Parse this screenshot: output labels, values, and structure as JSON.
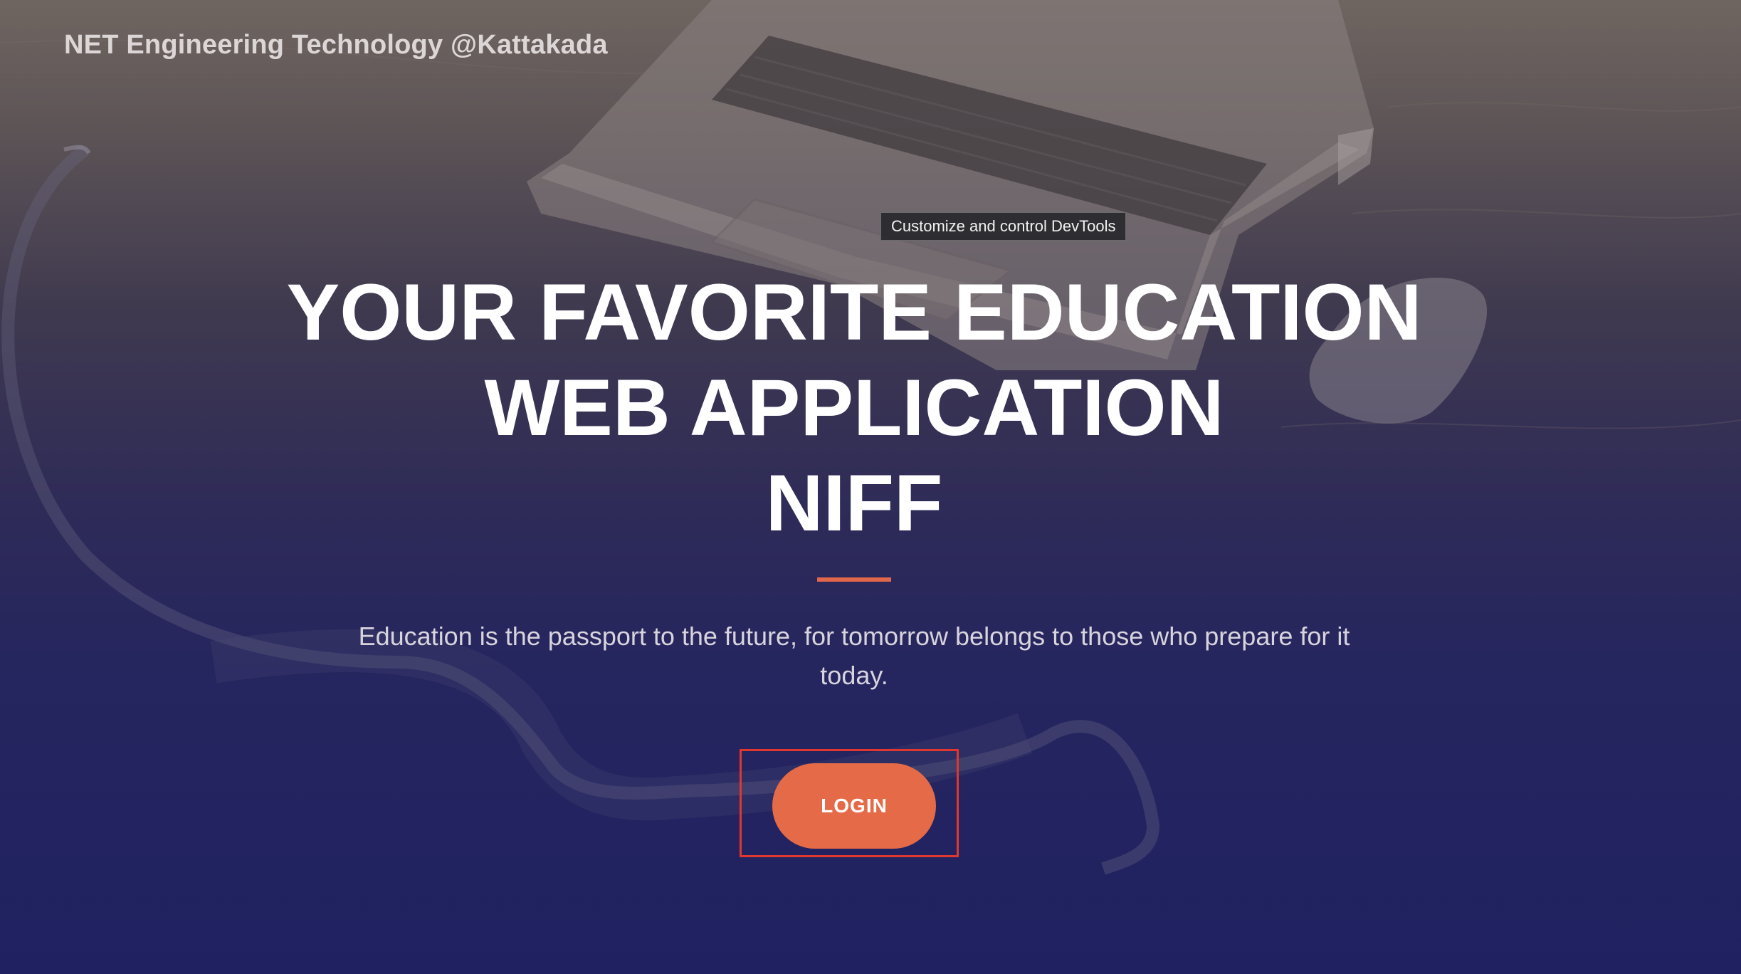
{
  "header": {
    "brand": "NET Engineering Technology @Kattakada"
  },
  "tooltip": {
    "text": "Customize and control DevTools"
  },
  "hero": {
    "headline_line1": "YOUR FAVORITE EDUCATION",
    "headline_line2": "WEB APPLICATION",
    "headline_line3": "NIFF",
    "tagline": "Education is the passport to the future, for tomorrow belongs to those who prepare for it today.",
    "login_label": "LOGIN"
  },
  "colors": {
    "accent": "#e56a47",
    "highlight_border": "#e0372e",
    "background_bottom": "#1f2161"
  },
  "icons": {
    "background": "laptop-desk-photo"
  }
}
